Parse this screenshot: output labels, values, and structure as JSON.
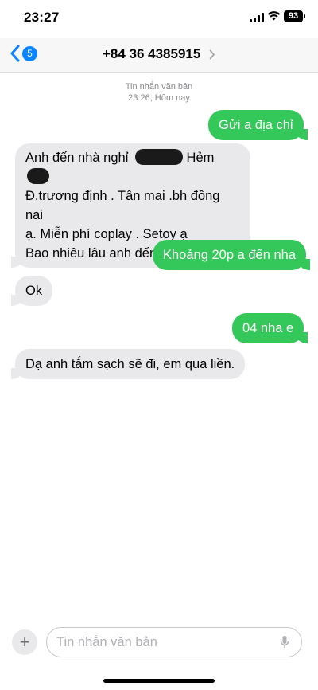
{
  "status_bar": {
    "time": "23:27",
    "battery": "93"
  },
  "nav": {
    "back_badge": "5",
    "contact": "+84 36 4385915"
  },
  "thread_meta": {
    "service": "Tin nhắn văn bản",
    "timestamp": "23:26, Hôm nay"
  },
  "messages": {
    "m1": {
      "text": "Gửi a địa chỉ"
    },
    "m2": {
      "l1a": "Anh đến nhà nghỉ",
      "l1b": " Hẻm",
      "l2": "Đ.trương định . Tân mai .bh  đồng nai",
      "l3": "ạ. Miễn phí coplay . Setoy ạ",
      "l4": "Bao nhiêu lâu anh đến ạ ?"
    },
    "m3": {
      "text": "Khoảng 20p a đến nha"
    },
    "m4": {
      "text": "Ok"
    },
    "m5": {
      "text": "04 nha e"
    },
    "m6": {
      "text": "Dạ anh tắm sạch sẽ đi, em qua liền."
    }
  },
  "composer": {
    "placeholder": "Tin nhắn văn bản"
  },
  "colors": {
    "outgoing_bubble": "#34c759",
    "incoming_bubble": "#e9e9eb",
    "accent": "#0a84ff"
  }
}
